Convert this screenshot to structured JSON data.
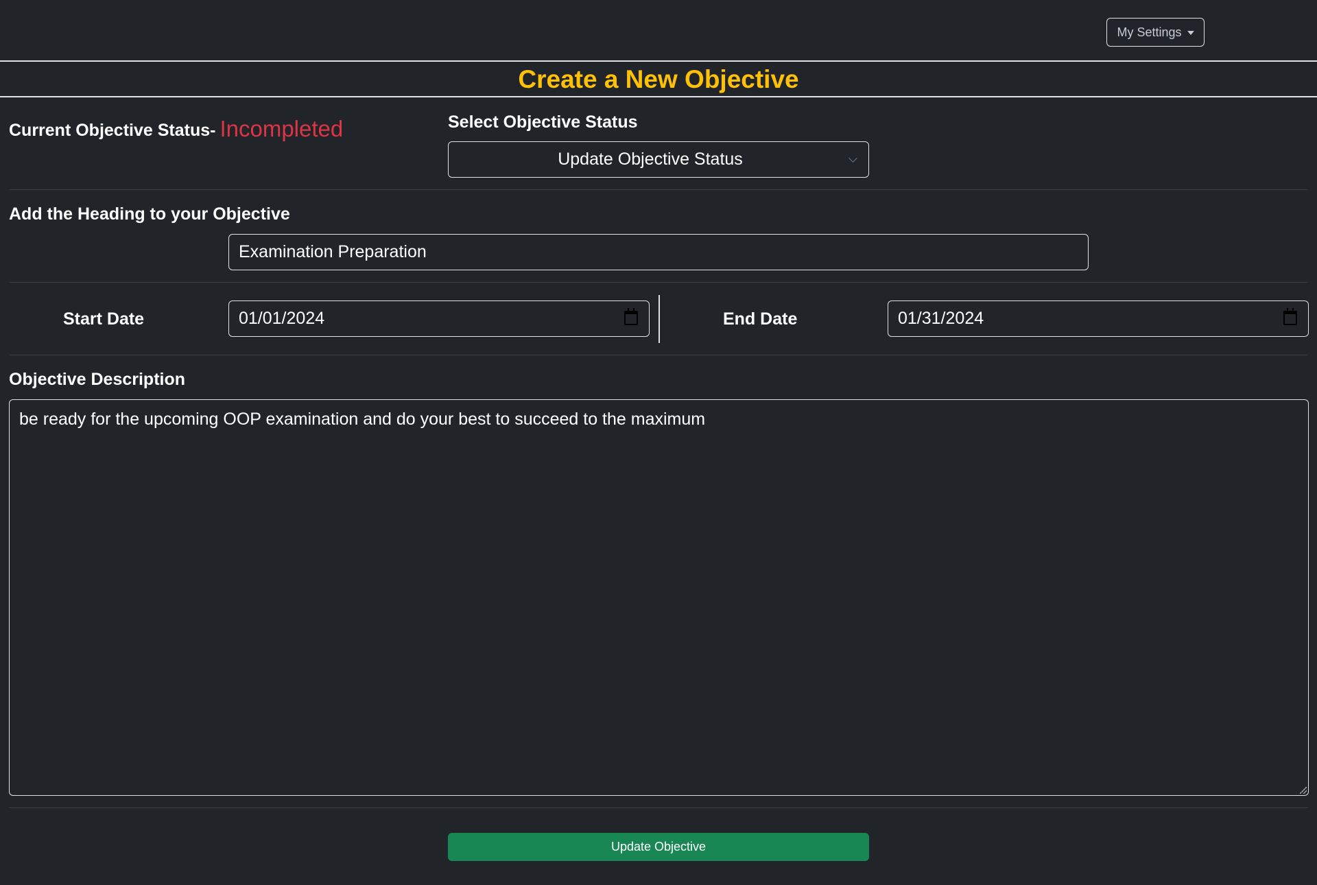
{
  "header": {
    "settings_label": "My Settings"
  },
  "page": {
    "title": "Create a New Objective"
  },
  "status": {
    "current_label": "Current Objective Status-",
    "current_value": "Incompleted",
    "current_value_color": "#dc3545",
    "select_label": "Select Objective Status",
    "select_value": "Update Objective Status"
  },
  "heading": {
    "label": "Add the Heading to your Objective",
    "value": "Examination Preparation"
  },
  "dates": {
    "start_label": "Start Date",
    "start_value": "01/01/2024",
    "end_label": "End Date",
    "end_value": "01/31/2024"
  },
  "description": {
    "label": "Objective Description",
    "value": "be ready for the upcoming OOP examination and do your best to succeed to the maximum"
  },
  "actions": {
    "submit_label": "Update Objective",
    "submit_color": "#198754"
  },
  "theme": {
    "background": "#212529",
    "title_color": "#ffc107"
  }
}
